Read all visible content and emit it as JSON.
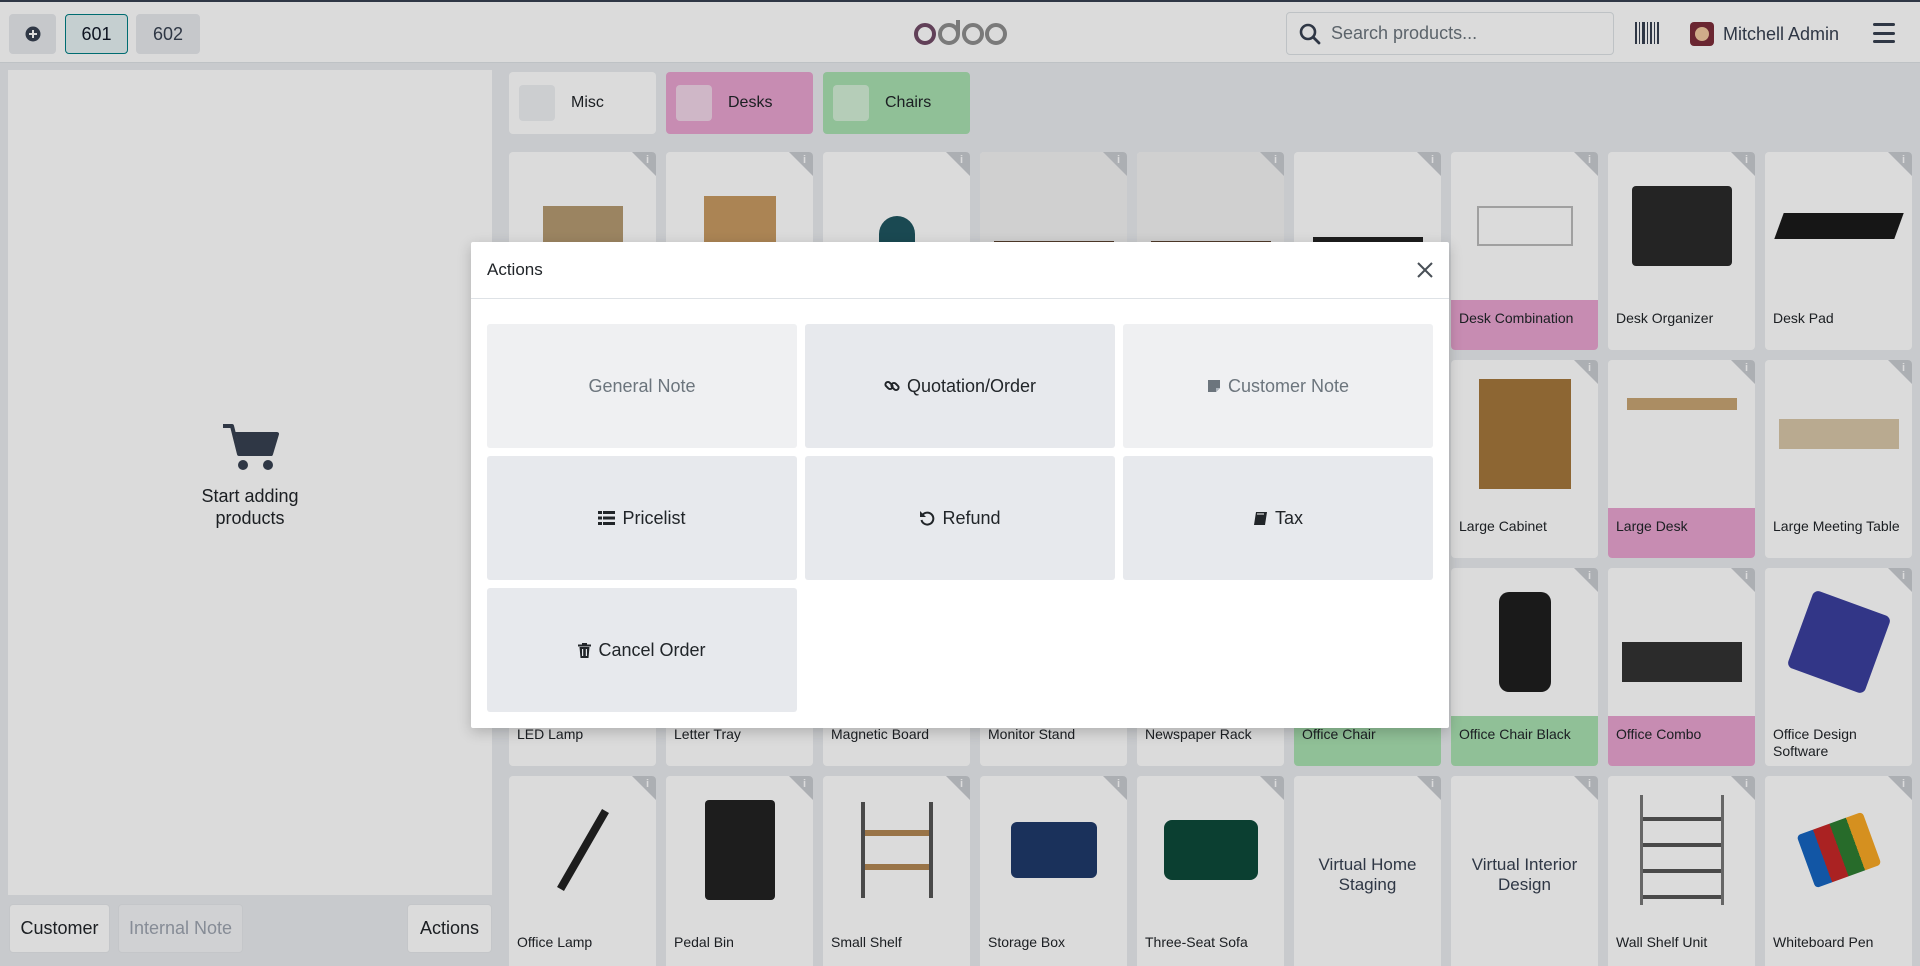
{
  "topbar": {
    "new_order_icon": "plus-circle-icon",
    "tabs": [
      "601",
      "602"
    ],
    "logo_text": "odoo",
    "search_placeholder": "Search products...",
    "user_name": "Mitchell Admin"
  },
  "cart": {
    "empty_text_line1": "Start adding",
    "empty_text_line2": "products"
  },
  "bottom": {
    "customer": "Customer",
    "internal_note": "Internal Note",
    "actions": "Actions"
  },
  "categories": [
    {
      "label": "Misc",
      "color": "#ffffff"
    },
    {
      "label": "Desks",
      "color": "#e8a3d0"
    },
    {
      "label": "Chairs",
      "color": "#a8e0b0"
    }
  ],
  "products": {
    "row2": [
      "Desk Combination",
      "Desk Organizer",
      "Desk Pad"
    ],
    "row3": [
      "Large Cabinet",
      "Large Desk",
      "Large Meeting Table"
    ],
    "row4": [
      "LED Lamp",
      "Letter Tray",
      "Magnetic Board",
      "Monitor Stand",
      "Newspaper Rack",
      "Office Chair",
      "Office Chair Black",
      "Office Combo",
      "Office Design Software"
    ],
    "row5": [
      "Office Lamp",
      "Pedal Bin",
      "Small Shelf",
      "Storage Box",
      "Three-Seat Sofa",
      "Virtual Home Staging",
      "Virtual Interior Design",
      "Wall Shelf Unit",
      "Whiteboard Pen"
    ]
  },
  "modal": {
    "title": "Actions",
    "buttons": [
      {
        "label": "General Note",
        "icon": ""
      },
      {
        "label": "Quotation/Order",
        "icon": "link-icon"
      },
      {
        "label": "Customer Note",
        "icon": "note-icon"
      },
      {
        "label": "Pricelist",
        "icon": "list-icon"
      },
      {
        "label": "Refund",
        "icon": "undo-icon"
      },
      {
        "label": "Tax",
        "icon": "book-icon"
      },
      {
        "label": "Cancel Order",
        "icon": "trash-icon"
      }
    ]
  },
  "colors": {
    "desk_category": "#e8a3d0",
    "chair_category": "#a8e0b0",
    "accent": "#017e84"
  }
}
